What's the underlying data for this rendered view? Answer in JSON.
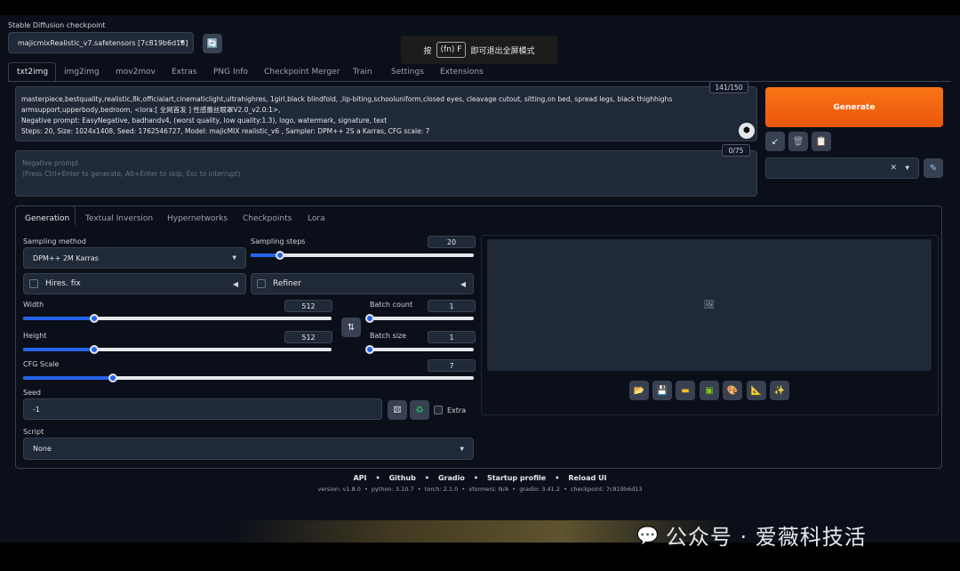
{
  "checkpoint": {
    "label": "Stable Diffusion checkpoint",
    "value": "majicmixRealistic_v7.safetensors [7c819b6d13]"
  },
  "overlay": {
    "prefix": "按",
    "key": "(fn) F",
    "suffix": "即可退出全屏模式"
  },
  "main_tabs": [
    "txt2img",
    "img2img",
    "mov2mov",
    "Extras",
    "PNG Info",
    "Checkpoint Merger",
    "Train",
    "Settings",
    "Extensions"
  ],
  "prompt": {
    "counter": "141/150",
    "lines": [
      "masterpiece,bestquality,realistic,8k,officialart,cinematiclight,ultrahighres, 1girl,black blindfold, ,lip-biting,schooluniform,closed eyes, cleavage cutout, sitting,on bed, spread legs, black thighhighs",
      "armsupport,upperbody,bedroom, <lora:[ 全网首发 ] 性感蕾丝眼罩V2.0_v2.0:1>,",
      "Negative prompt:  EasyNegative, badhandv4, (worst quality, low quality:1.3), logo, watermark, signature, text",
      "Steps: 20, Size: 1024x1408, Seed: 1762546727, Model: majicMIX realistic_v6 , Sampler: DPM++ 2S a Karras, CFG scale: 7"
    ]
  },
  "negative": {
    "counter": "0/75",
    "placeholder_line1": "Negative prompt",
    "placeholder_line2": "(Press Ctrl+Enter to generate, Alt+Enter to skip, Esc to interrupt)"
  },
  "generate_label": "Generate",
  "sub_tabs": [
    "Generation",
    "Textual Inversion",
    "Hypernetworks",
    "Checkpoints",
    "Lora"
  ],
  "sampling": {
    "method_label": "Sampling method",
    "method_value": "DPM++ 2M Karras",
    "steps_label": "Sampling steps",
    "steps_value": "20",
    "steps_fraction": 0.13
  },
  "hires_label": "Hires. fix",
  "refiner_label": "Refiner",
  "width": {
    "label": "Width",
    "value": "512",
    "fraction": 0.23
  },
  "height": {
    "label": "Height",
    "value": "512",
    "fraction": 0.23
  },
  "batch_count": {
    "label": "Batch count",
    "value": "1",
    "fraction": 0.0
  },
  "batch_size": {
    "label": "Batch size",
    "value": "1",
    "fraction": 0.0
  },
  "cfg": {
    "label": "CFG Scale",
    "value": "7",
    "fraction": 0.2
  },
  "seed": {
    "label": "Seed",
    "value": "-1",
    "extra_label": "Extra"
  },
  "script": {
    "label": "Script",
    "value": "None"
  },
  "footer": {
    "links": [
      "API",
      "Github",
      "Gradio",
      "Startup profile",
      "Reload UI"
    ],
    "separator": "•",
    "version_line": "version: v1.8.0  •  python: 3.10.7  •  torch: 2.1.0  •  xformers: N/A  •  gradio: 3.41.2  •  checkpoint: 7c819b6d13"
  },
  "watermark": "公众号 · 爱薇科技活",
  "colors": {
    "accent": "#f97316",
    "slider": "#2563eb",
    "bg": "#0b0f19",
    "panel": "#1f2937"
  }
}
